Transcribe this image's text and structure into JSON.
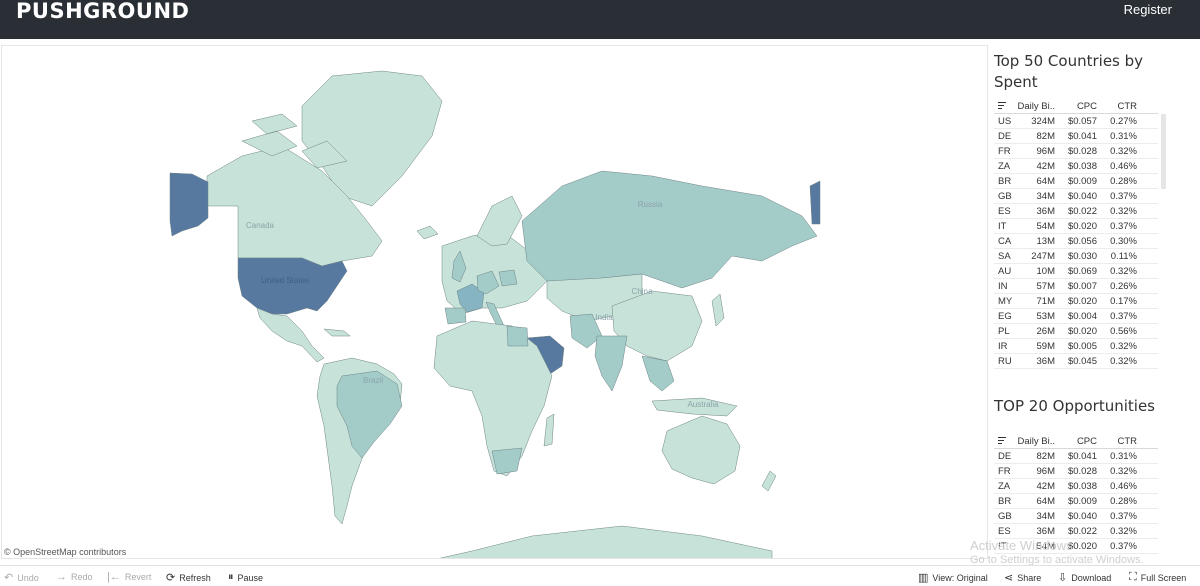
{
  "header": {
    "logo": "PUSHGROUND",
    "register": "Register"
  },
  "map": {
    "attribution": "© OpenStreetMap contributors",
    "labels": {
      "russia": "Russia",
      "canada": "Canada",
      "united_states": "United States",
      "china": "China",
      "india": "India",
      "brazil": "Brazil",
      "australia": "Australia"
    },
    "colors": {
      "water": "#ffffff",
      "land": "#c6e2d9",
      "land_mid": "#a3ccc9",
      "land_strong": "#86b4c3",
      "highlight": "#5779a0",
      "border": "#6f8486"
    }
  },
  "top50": {
    "title": "Top 50 Countries by Spent",
    "headers": {
      "bid": "Daily Bi..",
      "cpc": "CPC",
      "ctr": "CTR"
    },
    "rows": [
      {
        "code": "US",
        "bid": "324M",
        "cpc": "$0.057",
        "ctr": "0.27%"
      },
      {
        "code": "DE",
        "bid": "82M",
        "cpc": "$0.041",
        "ctr": "0.31%"
      },
      {
        "code": "FR",
        "bid": "96M",
        "cpc": "$0.028",
        "ctr": "0.32%"
      },
      {
        "code": "ZA",
        "bid": "42M",
        "cpc": "$0.038",
        "ctr": "0.46%"
      },
      {
        "code": "BR",
        "bid": "64M",
        "cpc": "$0.009",
        "ctr": "0.28%"
      },
      {
        "code": "GB",
        "bid": "34M",
        "cpc": "$0.040",
        "ctr": "0.37%"
      },
      {
        "code": "ES",
        "bid": "36M",
        "cpc": "$0.022",
        "ctr": "0.32%"
      },
      {
        "code": "IT",
        "bid": "54M",
        "cpc": "$0.020",
        "ctr": "0.37%"
      },
      {
        "code": "CA",
        "bid": "13M",
        "cpc": "$0.056",
        "ctr": "0.30%"
      },
      {
        "code": "SA",
        "bid": "247M",
        "cpc": "$0.030",
        "ctr": "0.11%"
      },
      {
        "code": "AU",
        "bid": "10M",
        "cpc": "$0.069",
        "ctr": "0.32%"
      },
      {
        "code": "IN",
        "bid": "57M",
        "cpc": "$0.007",
        "ctr": "0.26%"
      },
      {
        "code": "MY",
        "bid": "71M",
        "cpc": "$0.020",
        "ctr": "0.17%"
      },
      {
        "code": "EG",
        "bid": "53M",
        "cpc": "$0.004",
        "ctr": "0.37%"
      },
      {
        "code": "PL",
        "bid": "26M",
        "cpc": "$0.020",
        "ctr": "0.56%"
      },
      {
        "code": "IR",
        "bid": "59M",
        "cpc": "$0.005",
        "ctr": "0.32%"
      },
      {
        "code": "RU",
        "bid": "36M",
        "cpc": "$0.045",
        "ctr": "0.32%"
      }
    ]
  },
  "top20": {
    "title": "TOP 20 Opportunities",
    "headers": {
      "bid": "Daily Bi..",
      "cpc": "CPC",
      "ctr": "CTR"
    },
    "rows": [
      {
        "code": "DE",
        "bid": "82M",
        "cpc": "$0.041",
        "ctr": "0.31%"
      },
      {
        "code": "FR",
        "bid": "96M",
        "cpc": "$0.028",
        "ctr": "0.32%"
      },
      {
        "code": "ZA",
        "bid": "42M",
        "cpc": "$0.038",
        "ctr": "0.46%"
      },
      {
        "code": "BR",
        "bid": "64M",
        "cpc": "$0.009",
        "ctr": "0.28%"
      },
      {
        "code": "GB",
        "bid": "34M",
        "cpc": "$0.040",
        "ctr": "0.37%"
      },
      {
        "code": "ES",
        "bid": "36M",
        "cpc": "$0.022",
        "ctr": "0.32%"
      },
      {
        "code": "IT",
        "bid": "54M",
        "cpc": "$0.020",
        "ctr": "0.37%"
      }
    ]
  },
  "toolbar": {
    "undo": "Undo",
    "redo": "Redo",
    "revert": "Revert",
    "refresh": "Refresh",
    "pause": "Pause",
    "view": "View: Original",
    "share": "Share",
    "download": "Download",
    "fullscreen": "Full Screen"
  },
  "watermark": {
    "line1": "Activate Windows",
    "line2": "Go to Settings to activate Windows."
  }
}
